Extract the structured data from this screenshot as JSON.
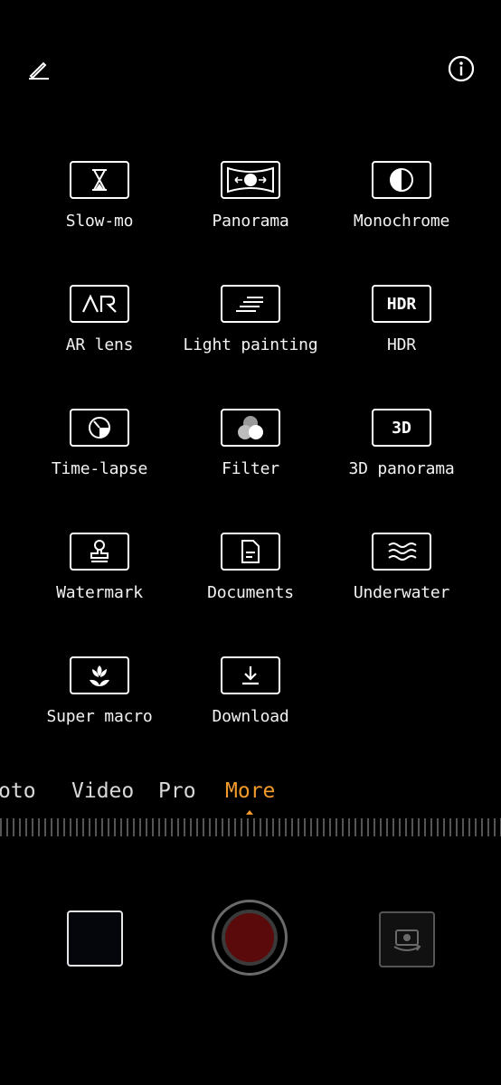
{
  "top": {
    "edit_icon": "pencil-icon",
    "info_icon": "info-icon"
  },
  "modes": [
    {
      "label": "Slow-mo",
      "icon": "hourglass-icon"
    },
    {
      "label": "Panorama",
      "icon": "panorama-icon"
    },
    {
      "label": "Monochrome",
      "icon": "monochrome-icon"
    },
    {
      "label": "AR lens",
      "icon": "ar-icon"
    },
    {
      "label": "Light painting",
      "icon": "light-painting-icon"
    },
    {
      "label": "HDR",
      "icon": "hdr-icon",
      "glyph": "HDR"
    },
    {
      "label": "Time-lapse",
      "icon": "timelapse-icon"
    },
    {
      "label": "Filter",
      "icon": "filter-icon"
    },
    {
      "label": "3D panorama",
      "icon": "3d-icon",
      "glyph": "3D"
    },
    {
      "label": "Watermark",
      "icon": "stamp-icon"
    },
    {
      "label": "Documents",
      "icon": "document-icon"
    },
    {
      "label": "Underwater",
      "icon": "waves-icon"
    },
    {
      "label": "Super macro",
      "icon": "flower-icon"
    },
    {
      "label": "Download",
      "icon": "download-icon"
    }
  ],
  "tabs": {
    "photo": "oto",
    "video": "Video",
    "pro": "Pro",
    "more": "More"
  },
  "colors": {
    "accent": "#f39a2c"
  }
}
